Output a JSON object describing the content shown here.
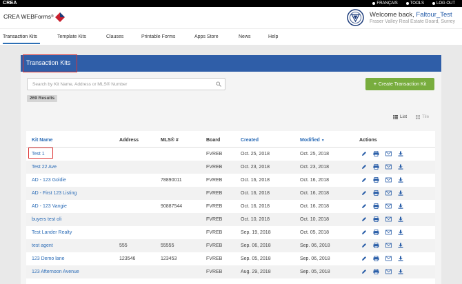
{
  "topbar": {
    "brand": "CREA",
    "links": [
      "FRANÇAIS",
      "TOOLS",
      "LOG OUT"
    ]
  },
  "header": {
    "logo_text": "CREA WEBForms",
    "logo_reg": "®",
    "welcome_prefix": "Welcome back, ",
    "username": "Faltour_Test",
    "board": "Fraser Valley Real Estate Board, Surrey"
  },
  "nav": {
    "tabs": [
      "Transaction Kits",
      "Template Kits",
      "Clauses",
      "Printable Forms",
      "Apps Store",
      "News",
      "Help"
    ],
    "active": "Transaction Kits"
  },
  "page": {
    "title": "Transaction Kits",
    "search_placeholder": "Search by Kit Name, Address or MLS® Number",
    "create_button": "Create Transaction Kit",
    "results": "269 Results",
    "view_list": "List",
    "view_tile": "Tile"
  },
  "table": {
    "headers": [
      "Kit Name",
      "Address",
      "MLS® #",
      "Board",
      "Created",
      "Modified",
      "Actions"
    ],
    "sort_indicator": "▼",
    "rows": [
      {
        "name": "Test 1",
        "address": "",
        "mls": "",
        "board": "FVREB",
        "created": "Oct. 25, 2018",
        "modified": "Oct. 25, 2018"
      },
      {
        "name": "Test 22 Ave",
        "address": "",
        "mls": "",
        "board": "FVREB",
        "created": "Oct. 23, 2018",
        "modified": "Oct. 23, 2018"
      },
      {
        "name": "AD - 123 Goldie",
        "address": "",
        "mls": "78890011",
        "board": "FVREB",
        "created": "Oct. 16, 2018",
        "modified": "Oct. 16, 2018"
      },
      {
        "name": "AD - First 123 Listing",
        "address": "",
        "mls": "",
        "board": "FVREB",
        "created": "Oct. 16, 2018",
        "modified": "Oct. 16, 2018"
      },
      {
        "name": "AD - 123 Vangie",
        "address": "",
        "mls": "90887544",
        "board": "FVREB",
        "created": "Oct. 16, 2018",
        "modified": "Oct. 16, 2018"
      },
      {
        "name": "buyers test oli",
        "address": "",
        "mls": "",
        "board": "FVREB",
        "created": "Oct. 10, 2018",
        "modified": "Oct. 10, 2018"
      },
      {
        "name": "Test Lander Realty",
        "address": "",
        "mls": "",
        "board": "FVREB",
        "created": "Sep. 19, 2018",
        "modified": "Oct. 05, 2018"
      },
      {
        "name": "test agent",
        "address": "555",
        "mls": "55555",
        "board": "FVREB",
        "created": "Sep. 06, 2018",
        "modified": "Sep. 06, 2018"
      },
      {
        "name": "123 Demo lane",
        "address": "123546",
        "mls": "123453",
        "board": "FVREB",
        "created": "Sep. 05, 2018",
        "modified": "Sep. 06, 2018"
      },
      {
        "name": "123 Afternoon Avenue",
        "address": "",
        "mls": "",
        "board": "FVREB",
        "created": "Aug. 29, 2018",
        "modified": "Sep. 05, 2018"
      }
    ]
  },
  "colors": {
    "banner": "#2f5ea8",
    "link": "#2a6bb6",
    "create": "#78ad3e",
    "highlight": "#d33333"
  }
}
